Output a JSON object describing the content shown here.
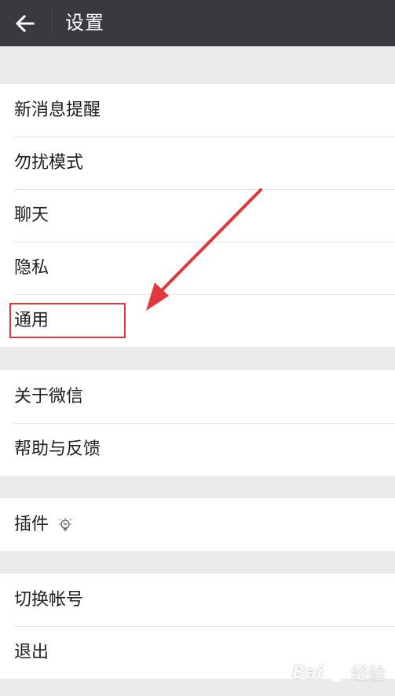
{
  "header": {
    "title": "设置",
    "back_icon": "arrow-left-icon"
  },
  "groups": [
    {
      "items": [
        "新消息提醒",
        "勿扰模式",
        "聊天",
        "隐私",
        "通用"
      ]
    },
    {
      "items": [
        "关于微信",
        "帮助与反馈"
      ]
    },
    {
      "items": [
        "插件"
      ]
    },
    {
      "items": [
        "切换帐号",
        "退出"
      ]
    }
  ],
  "annotation": {
    "highlight_color": "#e0383d",
    "pointer_icon": "red-arrow-icon"
  },
  "watermark": {
    "text_left": "Bai",
    "text_right": "经验",
    "icon": "paw-icon"
  },
  "colors": {
    "header_bg": "#393a3f",
    "page_bg": "#ebebeb",
    "row_bg": "#ffffff"
  }
}
